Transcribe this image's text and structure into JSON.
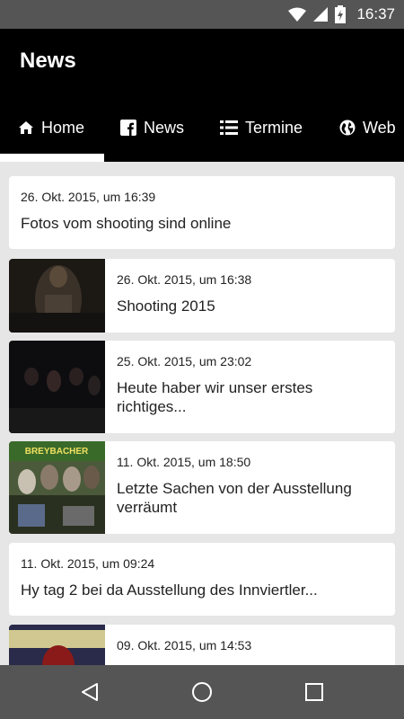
{
  "status_bar": {
    "time": "16:37"
  },
  "app_bar": {
    "title": "News"
  },
  "tabs": [
    {
      "label": "Home",
      "icon": "home-icon",
      "selected": true
    },
    {
      "label": "News",
      "icon": "facebook-icon",
      "selected": false
    },
    {
      "label": "Termine",
      "icon": "list-icon",
      "selected": false
    },
    {
      "label": "Web",
      "icon": "globe-icon",
      "selected": false
    }
  ],
  "posts": [
    {
      "date": "26. Okt. 2015, um 16:39",
      "text": "Fotos vom shooting sind online",
      "has_image": false
    },
    {
      "date": "26. Okt. 2015, um 16:38",
      "text": "Shooting 2015",
      "has_image": true
    },
    {
      "date": "25. Okt. 2015, um 23:02",
      "text": "Heute haber wir unser erstes richtiges...",
      "has_image": true
    },
    {
      "date": "11. Okt. 2015, um 18:50",
      "text": "Letzte Sachen von der Ausstellung verräumt",
      "has_image": true
    },
    {
      "date": "11. Okt. 2015, um 09:24",
      "text": "Hy tag 2 bei da Ausstellung des Innviertler...",
      "has_image": false
    },
    {
      "date": "09. Okt. 2015, um 14:53",
      "text": "",
      "has_image": true
    }
  ],
  "thumbnails": {
    "post_4_sign_text": "BREYBACHER"
  },
  "colors": {
    "status_bar": "#555555",
    "app_bar": "#000000",
    "content_bg": "#e6e6e6",
    "card_bg": "#ffffff",
    "nav_bar": "#555555"
  }
}
